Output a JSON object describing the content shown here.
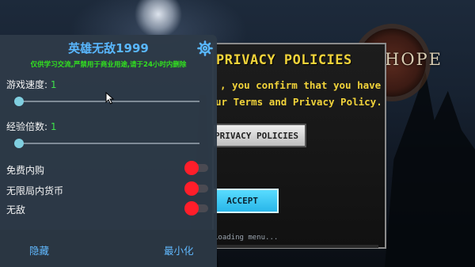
{
  "game": {
    "title_art": "HOPE",
    "loading_text": "Loading menu...",
    "dialog": {
      "title": "PRIVACY POLICIES",
      "body_lines": ", you confirm that you have|ur Terms and Privacy Policy.",
      "privacy_button": "PRIVACY POLICIES",
      "accept_button": "ACCEPT"
    }
  },
  "mod_menu": {
    "title": "英雄无敌1999",
    "settings_icon": "gear-icon",
    "notice": "仅供学习交流,严禁用于商业用途,请于24小时内删除",
    "sliders": [
      {
        "label": "游戏速度: ",
        "value": "1",
        "level": 0
      },
      {
        "label": "经验倍数: ",
        "value": "1",
        "level": 0
      }
    ],
    "toggles": [
      {
        "label": "免费内购",
        "on": false
      },
      {
        "label": "无限局内货币",
        "on": false
      },
      {
        "label": "无敌",
        "on": false
      }
    ],
    "footer": {
      "hide_label": "隐藏",
      "minimize_label": "最小化"
    },
    "colors": {
      "title": "#59b7ff",
      "notice": "#32e21f",
      "toggle": "#ff1e2a",
      "value": "#3fe14b"
    }
  }
}
